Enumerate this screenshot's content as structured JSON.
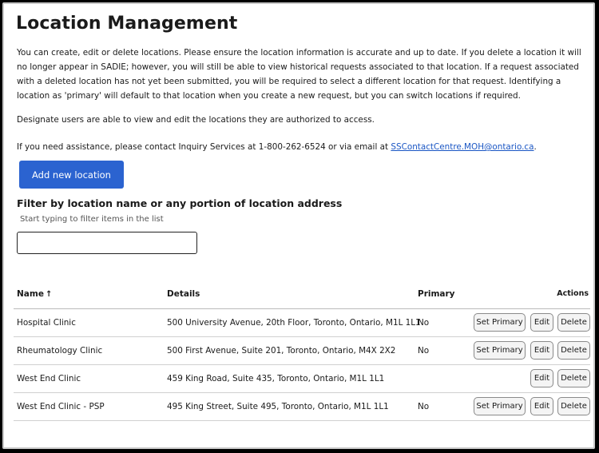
{
  "page": {
    "title": "Location Management",
    "intro": "You can create, edit or delete locations. Please ensure the location information is accurate and up to date. If you delete a location it will no longer appear in SADIE; however, you will still be able to view historical requests associated to that location. If a request associated with a deleted location has not yet been submitted, you will be required to select a different location for that request. Identifying a location as 'primary' will default to that location when you create a new request, but you can switch locations if required.",
    "designate_note": "Designate users are able to view and edit the locations they are authorized to access.",
    "assistance_prefix": "If you need assistance, please contact Inquiry Services at 1-800-262-6524 or via email at ",
    "assistance_email": "SSContactCentre.MOH@ontario.ca",
    "assistance_suffix": "."
  },
  "add_button": {
    "label": "Add new location"
  },
  "filter": {
    "label": "Filter by location name or any portion of location address",
    "hint": "Start typing to filter items in the list",
    "value": ""
  },
  "table": {
    "headers": {
      "name": "Name",
      "sort_arrow": "↑",
      "details": "Details",
      "primary": "Primary",
      "actions": "Actions"
    },
    "action_labels": {
      "set_primary": "Set Primary",
      "edit": "Edit",
      "delete": "Delete"
    },
    "rows": [
      {
        "name": "Hospital Clinic",
        "details": "500 University Avenue, 20th Floor, Toronto, Ontario, M1L 1L1",
        "primary": "No"
      },
      {
        "name": "Rheumatology Clinic",
        "details": "500 First Avenue, Suite 201, Toronto, Ontario, M4X 2X2",
        "primary": "No"
      },
      {
        "name": "West End Clinic",
        "details": "459 King Road, Suite 435, Toronto, Ontario, M1L 1L1",
        "primary": ""
      },
      {
        "name": "West End Clinic - PSP",
        "details": "495 King Street, Suite 495, Toronto, Ontario, M1L 1L1",
        "primary": "No"
      }
    ]
  }
}
